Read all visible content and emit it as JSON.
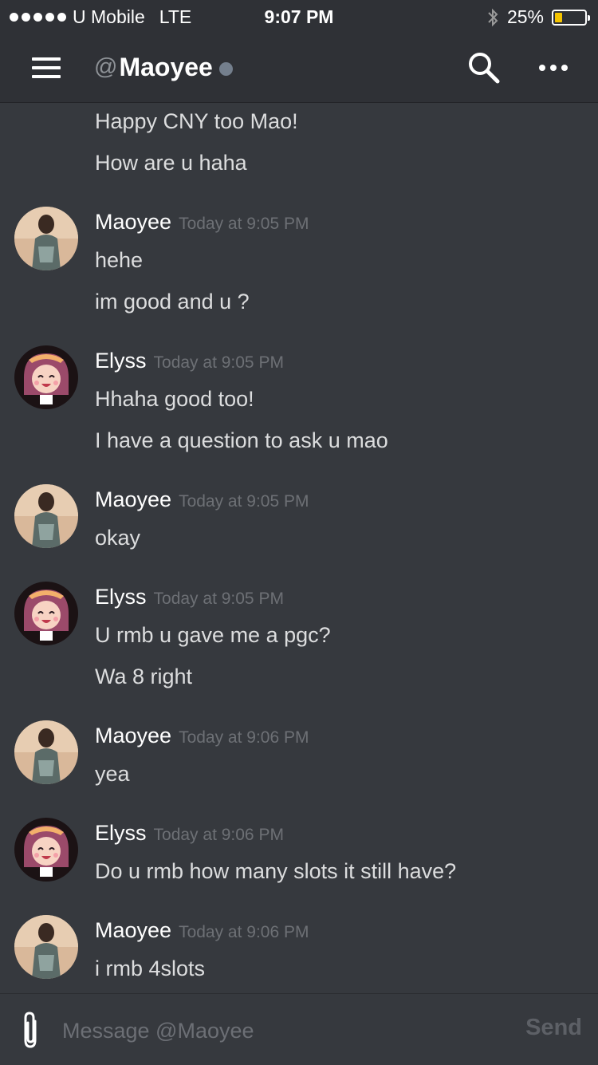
{
  "status_bar": {
    "carrier": "U Mobile",
    "network": "LTE",
    "time": "9:07 PM",
    "battery": "25%",
    "battery_level": 0.25
  },
  "header": {
    "at": "@",
    "channel_name": "Maoyee",
    "presence": "offline"
  },
  "continuation_lines": [
    "Happy CNY too Mao!",
    "How are u haha"
  ],
  "groups": [
    {
      "author": "Maoyee",
      "timestamp": "Today at 9:05 PM",
      "lines": [
        "hehe",
        "im good and u ?"
      ]
    },
    {
      "author": "Elyss",
      "timestamp": "Today at 9:05 PM",
      "lines": [
        "Hhaha good too!",
        "I have a question to ask u mao"
      ]
    },
    {
      "author": "Maoyee",
      "timestamp": "Today at 9:05 PM",
      "lines": [
        "okay"
      ]
    },
    {
      "author": "Elyss",
      "timestamp": "Today at 9:05 PM",
      "lines": [
        "U rmb u gave me a pgc?",
        "Wa 8 right"
      ]
    },
    {
      "author": "Maoyee",
      "timestamp": "Today at 9:06 PM",
      "lines": [
        "yea"
      ]
    },
    {
      "author": "Elyss",
      "timestamp": "Today at 9:06 PM",
      "lines": [
        "Do u rmb how many slots it still have?"
      ]
    },
    {
      "author": "Maoyee",
      "timestamp": "Today at 9:06 PM",
      "lines": [
        "i rmb 4slots"
      ]
    }
  ],
  "composer": {
    "placeholder": "Message @Maoyee",
    "send_label": "Send"
  },
  "colors": {
    "background": "#36393e",
    "header": "#2f3136",
    "battery_fill": "#f5c400",
    "presence_offline": "#747f8d"
  }
}
